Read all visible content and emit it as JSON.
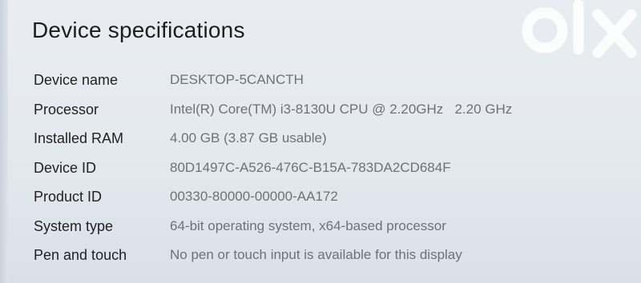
{
  "page": {
    "title": "Device specifications"
  },
  "specs": [
    {
      "label": "Device name",
      "value": "DESKTOP-5CANCTH"
    },
    {
      "label": "Processor",
      "value": "Intel(R) Core(TM) i3-8130U CPU @ 2.20GHz   2.20 GHz"
    },
    {
      "label": "Installed RAM",
      "value": "4.00 GB (3.87 GB usable)"
    },
    {
      "label": "Device ID",
      "value": "80D1497C-A526-476C-B15A-783DA2CD684F"
    },
    {
      "label": "Product ID",
      "value": "00330-80000-00000-AA172"
    },
    {
      "label": "System type",
      "value": "64-bit operating system, x64-based processor"
    },
    {
      "label": "Pen and touch",
      "value": "No pen or touch input is available for this display"
    }
  ],
  "watermark": {
    "text": "olx",
    "color": "#ffffff"
  }
}
